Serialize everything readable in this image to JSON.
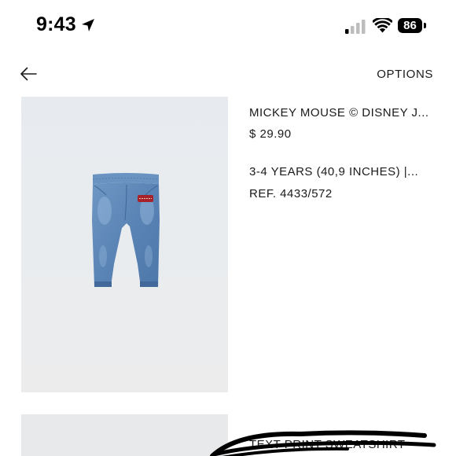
{
  "status_bar": {
    "time": "9:43",
    "battery_level": "86"
  },
  "header": {
    "options_label": "OPTIONS"
  },
  "products": [
    {
      "name": "MICKEY MOUSE © DISNEY J...",
      "price": "$ 29.90",
      "size": "3-4 YEARS (40,9 INCHES) |...",
      "ref": "REF. 4433/572"
    },
    {
      "name": "TEXT PRINT SWEATSHIRT"
    }
  ]
}
